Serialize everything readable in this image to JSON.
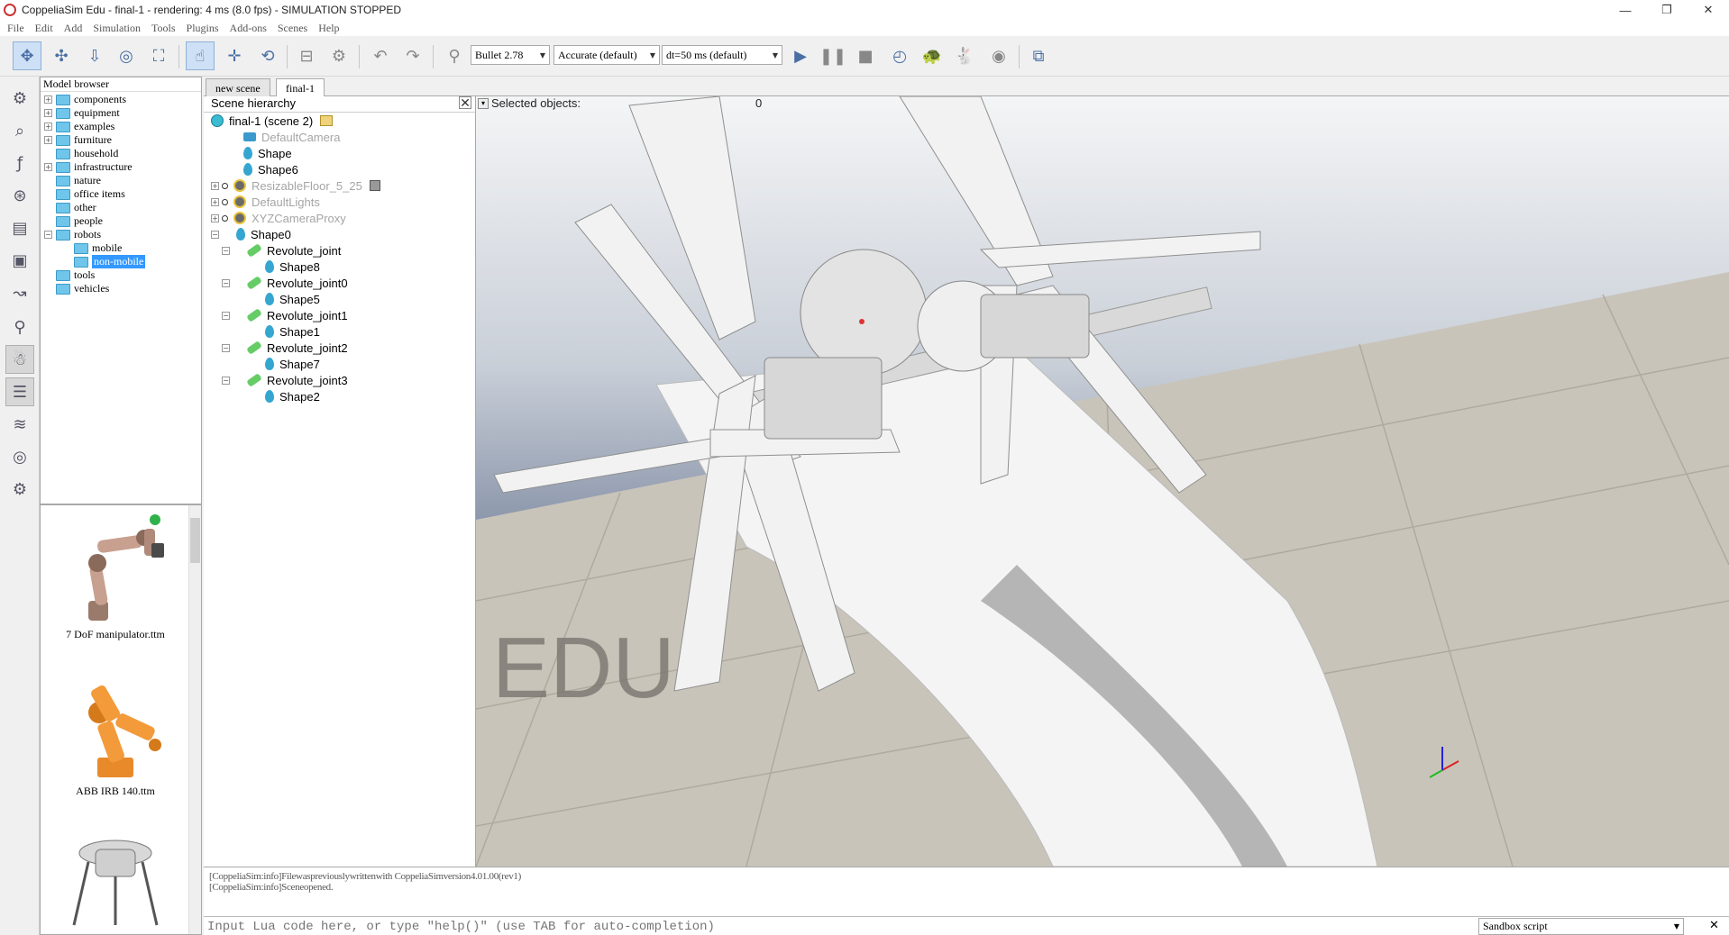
{
  "window": {
    "title": "CoppeliaSim Edu - final-1 - rendering: 4 ms (8.0 fps) - SIMULATION STOPPED",
    "minimize": "—",
    "restore": "❐",
    "close": "✕"
  },
  "menubar": [
    "File",
    "Edit",
    "Add",
    "Simulation",
    "Tools",
    "Plugins",
    "Add-ons",
    "Scenes",
    "Help"
  ],
  "toolbar": {
    "engine": "Bullet 2.78",
    "accuracy": "Accurate (default)",
    "timestep": "dt=50 ms (default)"
  },
  "model_browser": {
    "title": "Model browser",
    "items": [
      {
        "label": "components"
      },
      {
        "label": "equipment"
      },
      {
        "label": "examples"
      },
      {
        "label": "furniture"
      },
      {
        "label": "household"
      },
      {
        "label": "infrastructure"
      },
      {
        "label": "nature"
      },
      {
        "label": "office items"
      },
      {
        "label": "other"
      },
      {
        "label": "people"
      },
      {
        "label": "robots"
      },
      {
        "label": "mobile"
      },
      {
        "label": "non-mobile"
      },
      {
        "label": "tools"
      },
      {
        "label": "vehicles"
      }
    ]
  },
  "thumbnails": [
    {
      "label": "7 DoF manipulator.ttm"
    },
    {
      "label": "ABB IRB 140.ttm"
    }
  ],
  "tabs": [
    "new scene",
    "final-1"
  ],
  "hierarchy": {
    "title": "Scene hierarchy",
    "close": "✕",
    "rows": [
      {
        "label": "final-1 (scene 2)"
      },
      {
        "label": "DefaultCamera"
      },
      {
        "label": "Shape"
      },
      {
        "label": "Shape6"
      },
      {
        "label": "ResizableFloor_5_25"
      },
      {
        "label": "DefaultLights"
      },
      {
        "label": "XYZCameraProxy"
      },
      {
        "label": "Shape0"
      },
      {
        "label": "Revolute_joint"
      },
      {
        "label": "Shape8"
      },
      {
        "label": "Revolute_joint0"
      },
      {
        "label": "Shape5"
      },
      {
        "label": "Revolute_joint1"
      },
      {
        "label": "Shape1"
      },
      {
        "label": "Revolute_joint2"
      },
      {
        "label": "Shape7"
      },
      {
        "label": "Revolute_joint3"
      },
      {
        "label": "Shape2"
      }
    ]
  },
  "viewport": {
    "selected_label": "Selected objects:",
    "selected_count": "0",
    "watermark": "EDU"
  },
  "console": {
    "lines": [
      "[CoppeliaSim:info]Filewaspreviouslywrittenwith CoppeliaSimversion4.01.00(rev1)",
      "[CoppeliaSim:info]Sceneopened."
    ]
  },
  "command": {
    "placeholder": "Input Lua code here, or type \"help()\" (use TAB for auto-completion)",
    "script": "Sandbox script",
    "close": "✕"
  },
  "colors": {
    "selection": "#3399ff",
    "folder": "#6fc5ea",
    "sky_top": "#f4f5f6",
    "sky_bottom": "#7e8aa1",
    "floor": "#c9c4ba"
  }
}
